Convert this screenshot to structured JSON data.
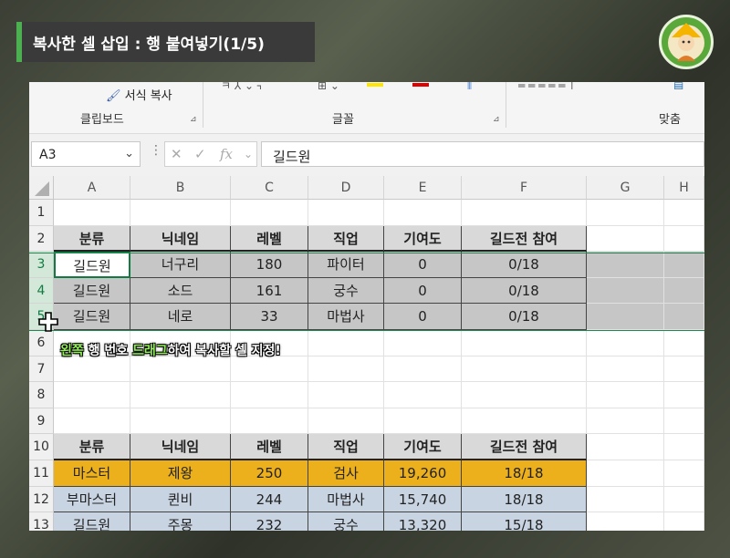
{
  "overlay": {
    "title": "복사한 셀 삽입 : 행 붙여넣기(1/5)",
    "annotation_parts": [
      {
        "text": "왼쪽 ",
        "highlight": true
      },
      {
        "text": "행 번호 ",
        "highlight": false
      },
      {
        "text": "드래그",
        "highlight": true
      },
      {
        "text": "하여 복사할 셀 지정!",
        "highlight": false
      }
    ],
    "colors": {
      "accent": "#4caf50",
      "highlight_text": "#93f05a"
    }
  },
  "ribbon": {
    "clipboard_button": "서식 복사",
    "groups": [
      "클립보드",
      "글꼴",
      "맞춤"
    ],
    "icons": [
      "paintbrush-icon",
      "font-color-icon",
      "fill-color-icon",
      "border-icon",
      "align-icon"
    ]
  },
  "formula_bar": {
    "name_box": "A3",
    "formula": "길드원"
  },
  "sheet": {
    "column_headers": [
      "A",
      "B",
      "C",
      "D",
      "E",
      "F",
      "G",
      "H"
    ],
    "row_headers": [
      "1",
      "2",
      "3",
      "4",
      "5",
      "6",
      "7",
      "8",
      "9",
      "10",
      "11",
      "12",
      "13"
    ],
    "selected_rows": [
      "3",
      "4",
      "5"
    ],
    "active_cell": "A3",
    "table1": {
      "header": [
        "분류",
        "닉네임",
        "레벨",
        "직업",
        "기여도",
        "길드전 참여"
      ],
      "rows": [
        [
          "길드원",
          "너구리",
          "180",
          "파이터",
          "0",
          "0/18"
        ],
        [
          "길드원",
          "소드",
          "161",
          "궁수",
          "0",
          "0/18"
        ],
        [
          "길드원",
          "네로",
          "33",
          "마법사",
          "0",
          "0/18"
        ]
      ]
    },
    "table2": {
      "header": [
        "분류",
        "닉네임",
        "레벨",
        "직업",
        "기여도",
        "길드전 참여"
      ],
      "rows": [
        [
          "마스터",
          "제왕",
          "250",
          "검사",
          "19,260",
          "18/18"
        ],
        [
          "부마스터",
          "퀸비",
          "244",
          "마법사",
          "15,740",
          "18/18"
        ],
        [
          "길드원",
          "주몽",
          "232",
          "궁수",
          "13,320",
          "15/18"
        ]
      ],
      "row_colors": [
        "#ecb01d",
        "#c9d4e3",
        "#c9d4e3"
      ]
    }
  }
}
